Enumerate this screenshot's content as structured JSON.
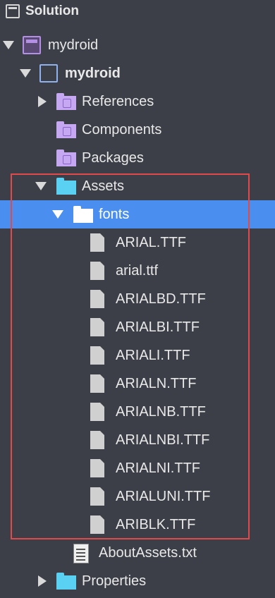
{
  "panel": {
    "title": "Solution"
  },
  "tree": {
    "solution_item": "mydroid",
    "project_item": "mydroid",
    "references": "References",
    "components": "Components",
    "packages": "Packages",
    "assets": "Assets",
    "fonts": "fonts",
    "font_files": [
      "ARIAL.TTF",
      "arial.ttf",
      "ARIALBD.TTF",
      "ARIALBI.TTF",
      "ARIALI.TTF",
      "ARIALN.TTF",
      "ARIALNB.TTF",
      "ARIALNBI.TTF",
      "ARIALNI.TTF",
      "ARIALUNI.TTF",
      "ARIBLK.TTF"
    ],
    "about_assets": "AboutAssets.txt",
    "properties": "Properties"
  },
  "colors": {
    "background": "#3c3f47",
    "selection": "#4a8ef0",
    "highlight_box": "#e04a4a"
  }
}
